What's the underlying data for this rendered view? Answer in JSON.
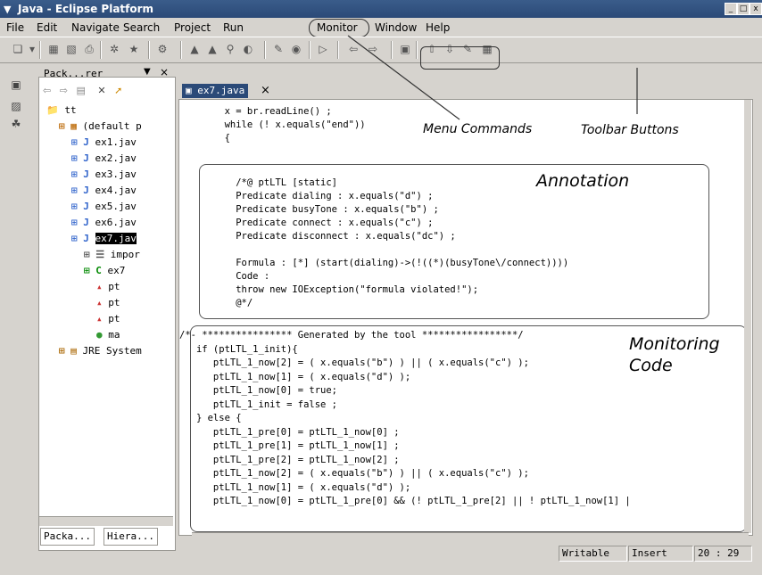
{
  "window": {
    "title": "Java - Eclipse Platform",
    "menu_icon": "chevron-down-icon",
    "controls": [
      "_",
      "□",
      "x"
    ]
  },
  "menu": [
    "File",
    "Edit",
    "Navigate",
    "Search",
    "Project",
    "Run",
    "Monitor",
    "Window",
    "Help"
  ],
  "explorer": {
    "title": "Pack...rer",
    "tree": [
      {
        "label": "tt",
        "indent": 0,
        "icon": "project-icon"
      },
      {
        "label": "(default p",
        "indent": 1,
        "icon": "package-icon"
      },
      {
        "label": "ex1.jav",
        "indent": 2,
        "icon": "java-file-icon"
      },
      {
        "label": "ex2.jav",
        "indent": 2,
        "icon": "java-file-icon"
      },
      {
        "label": "ex3.jav",
        "indent": 2,
        "icon": "java-file-icon"
      },
      {
        "label": "ex4.jav",
        "indent": 2,
        "icon": "java-file-icon"
      },
      {
        "label": "ex5.jav",
        "indent": 2,
        "icon": "java-file-icon"
      },
      {
        "label": "ex6.jav",
        "indent": 2,
        "icon": "java-file-icon"
      },
      {
        "label": "ex7.jav",
        "indent": 2,
        "icon": "java-file-icon",
        "selected": true
      },
      {
        "label": "impor",
        "indent": 3,
        "icon": "imports-icon"
      },
      {
        "label": "ex7",
        "indent": 3,
        "icon": "class-icon"
      },
      {
        "label": "pt",
        "indent": 4,
        "icon": "field-icon"
      },
      {
        "label": "pt",
        "indent": 4,
        "icon": "field-icon"
      },
      {
        "label": "pt",
        "indent": 4,
        "icon": "field-icon"
      },
      {
        "label": "ma",
        "indent": 4,
        "icon": "method-icon"
      },
      {
        "label": "JRE System",
        "indent": 1,
        "icon": "library-icon"
      }
    ],
    "bottom_tabs": [
      "Packa...",
      "Hiera..."
    ]
  },
  "editor": {
    "tab_label": "ex7.java",
    "lines_top": [
      "        x = br.readLine() ;",
      "        while (! x.equals(\"end\"))",
      "        {"
    ],
    "annotation_lines": [
      "          /*@ ptLTL [static]",
      "          Predicate dialing : x.equals(\"d\") ;",
      "          Predicate busyTone : x.equals(\"b\") ;",
      "          Predicate connect : x.equals(\"c\") ;",
      "          Predicate disconnect : x.equals(\"dc\") ;",
      "",
      "          Formula : [*] (start(dialing)->(!((*)(busyTone\\/connect))))",
      "          Code :",
      "          throw new IOException(\"formula violated!\");",
      "          @*/"
    ],
    "monitor_lines": [
      "/*- **************** Generated by the tool *****************/",
      "   if (ptLTL_1_init){",
      "      ptLTL_1_now[2] = ( x.equals(\"b\") ) || ( x.equals(\"c\") );",
      "      ptLTL_1_now[1] = ( x.equals(\"d\") );",
      "      ptLTL_1_now[0] = true;",
      "      ptLTL_1_init = false ;",
      "   } else {",
      "      ptLTL_1_pre[0] = ptLTL_1_now[0] ;",
      "      ptLTL_1_pre[1] = ptLTL_1_now[1] ;",
      "      ptLTL_1_pre[2] = ptLTL_1_now[2] ;",
      "      ptLTL_1_now[2] = ( x.equals(\"b\") ) || ( x.equals(\"c\") );",
      "      ptLTL_1_now[1] = ( x.equals(\"d\") );",
      "      ptLTL_1_now[0] = ptLTL_1_pre[0] && (! ptLTL_1_pre[2] || ! ptLTL_1_now[1] |"
    ]
  },
  "callouts": {
    "menu_commands": "Menu Commands",
    "toolbar_buttons": "Toolbar Buttons",
    "annotation": "Annotation",
    "monitoring": "Monitoring",
    "code": "Code"
  },
  "status": {
    "writable": "Writable",
    "insert": "Insert",
    "position": "20 : 29"
  }
}
